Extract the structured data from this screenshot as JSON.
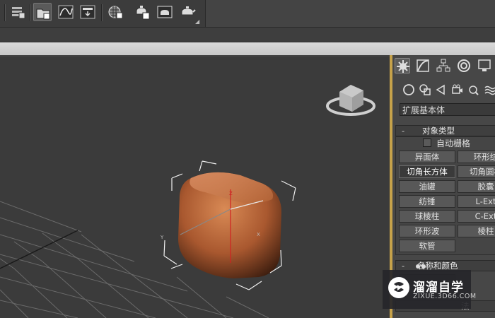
{
  "toolbar": {
    "icons": [
      "layer-list-icon",
      "scene-explorer-icon",
      "curve-editor-icon",
      "schematic-view-icon",
      "material-editor-icon",
      "render-setup-icon",
      "rendered-frame-icon",
      "render-teapot-icon"
    ]
  },
  "command_panel": {
    "tabs": [
      "create-tab",
      "modify-tab",
      "hierarchy-tab",
      "motion-tab",
      "display-tab"
    ],
    "sub_categories": [
      "geometry",
      "shapes",
      "lights",
      "cameras",
      "helpers",
      "space-warps"
    ],
    "dropdown_value": "扩展基本体",
    "object_type": {
      "title": "对象类型",
      "minus": "-",
      "autogrid_label": "自动栅格",
      "buttons": [
        [
          "异面体",
          "环形结"
        ],
        [
          "切角长方体",
          "切角圆柱"
        ],
        [
          "油罐",
          "胶囊"
        ],
        [
          "纺锤",
          "L-Ext"
        ],
        [
          "球棱柱",
          "C-Ext"
        ],
        [
          "环形波",
          "棱柱"
        ],
        [
          "软管",
          ""
        ]
      ],
      "selected": "切角长方体"
    },
    "name_color": {
      "title": "名称和颜色",
      "minus": "-"
    },
    "method_partial": "法"
  },
  "viewport": {
    "axis_label_z": "Z",
    "axis_label_y": "Y",
    "axis_label_x": "X"
  },
  "watermark": {
    "brand": "溜溜自学",
    "url": "ZIXUE.3D66.COM"
  },
  "colors": {
    "panel_bg": "#474747",
    "viewport_bg": "#3b3b3b",
    "viewport_active_border": "#c6a24a",
    "object_color": "#b8683f"
  }
}
